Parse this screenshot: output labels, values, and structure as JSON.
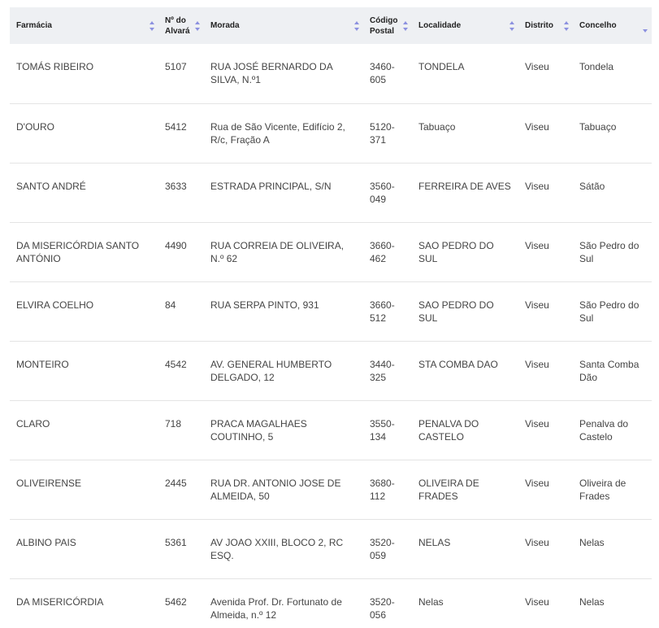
{
  "table": {
    "headers": [
      {
        "label": "Farmácia"
      },
      {
        "label": "Nº do Alvará"
      },
      {
        "label": "Morada"
      },
      {
        "label": "Código Postal"
      },
      {
        "label": "Localidade"
      },
      {
        "label": "Distrito"
      },
      {
        "label": "Concelho"
      }
    ],
    "rows": [
      [
        "TOMÁS RIBEIRO",
        "5107",
        "RUA JOSÉ BERNARDO DA SILVA, N.º1",
        "3460-605",
        "TONDELA",
        "Viseu",
        "Tondela"
      ],
      [
        "D'OURO",
        "5412",
        "Rua de São Vicente, Edifício 2, R/c, Fração A",
        "5120-371",
        "Tabuaço",
        "Viseu",
        "Tabuaço"
      ],
      [
        "SANTO ANDRÉ",
        "3633",
        "ESTRADA PRINCIPAL, S/N",
        "3560-049",
        "FERREIRA DE AVES",
        "Viseu",
        "Sátão"
      ],
      [
        "DA MISERICÓRDIA SANTO ANTÓNIO",
        "4490",
        "RUA CORREIA DE OLIVEIRA, N.º 62",
        "3660-462",
        "SAO PEDRO DO SUL",
        "Viseu",
        "São Pedro do Sul"
      ],
      [
        "ELVIRA COELHO",
        "84",
        "RUA SERPA PINTO, 931",
        "3660-512",
        "SAO PEDRO DO SUL",
        "Viseu",
        "São Pedro do Sul"
      ],
      [
        "MONTEIRO",
        "4542",
        "AV. GENERAL HUMBERTO DELGADO, 12",
        "3440-325",
        "STA COMBA DAO",
        "Viseu",
        "Santa Comba Dão"
      ],
      [
        "CLARO",
        "718",
        "PRACA MAGALHAES COUTINHO, 5",
        "3550-134",
        "PENALVA DO CASTELO",
        "Viseu",
        "Penalva do Castelo"
      ],
      [
        "OLIVEIRENSE",
        "2445",
        "RUA DR. ANTONIO JOSE DE ALMEIDA, 50",
        "3680-112",
        "OLIVEIRA DE FRADES",
        "Viseu",
        "Oliveira de Frades"
      ],
      [
        "ALBINO PAIS",
        "5361",
        "AV JOAO XXIII, BLOCO 2, RC ESQ.",
        "3520-059",
        "NELAS",
        "Viseu",
        "Nelas"
      ],
      [
        "DA MISERICÓRDIA",
        "5462",
        "Avenida Prof. Dr. Fortunato de Almeida, n.º 12",
        "3520-056",
        "Nelas",
        "Viseu",
        "Nelas"
      ]
    ]
  }
}
